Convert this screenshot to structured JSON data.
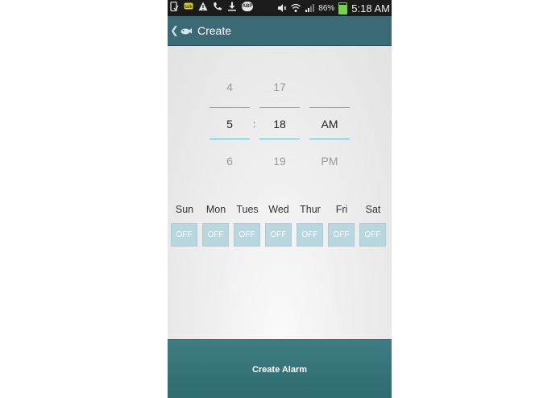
{
  "status_bar": {
    "battery": "86%",
    "time": "5:18 AM",
    "icons": [
      "phone-icon",
      "chat-icon",
      "warning-icon",
      "call-icon",
      "download-icon",
      "abp-icon",
      "mute-icon",
      "wifi-icon",
      "signal-icon",
      "battery-icon"
    ],
    "abp_text": "ABP"
  },
  "action_bar": {
    "back": "❮",
    "title": "Create"
  },
  "time_picker": {
    "hour": {
      "prev": "4",
      "current": "5",
      "next": "6"
    },
    "separator": ":",
    "minute": {
      "prev": "17",
      "current": "18",
      "next": "19"
    },
    "ampm": {
      "prev": "",
      "current": "AM",
      "next": "PM"
    }
  },
  "days": [
    {
      "label": "Sun",
      "state": "OFF"
    },
    {
      "label": "Mon",
      "state": "OFF"
    },
    {
      "label": "Tues",
      "state": "OFF"
    },
    {
      "label": "Wed",
      "state": "OFF"
    },
    {
      "label": "Thur",
      "state": "OFF"
    },
    {
      "label": "Fri",
      "state": "OFF"
    },
    {
      "label": "Sat",
      "state": "OFF"
    }
  ],
  "create_button": "Create Alarm",
  "colors": {
    "accent": "#3a6a73",
    "picker_line": "#5fb7d4",
    "off_button": "#b8d7df"
  }
}
